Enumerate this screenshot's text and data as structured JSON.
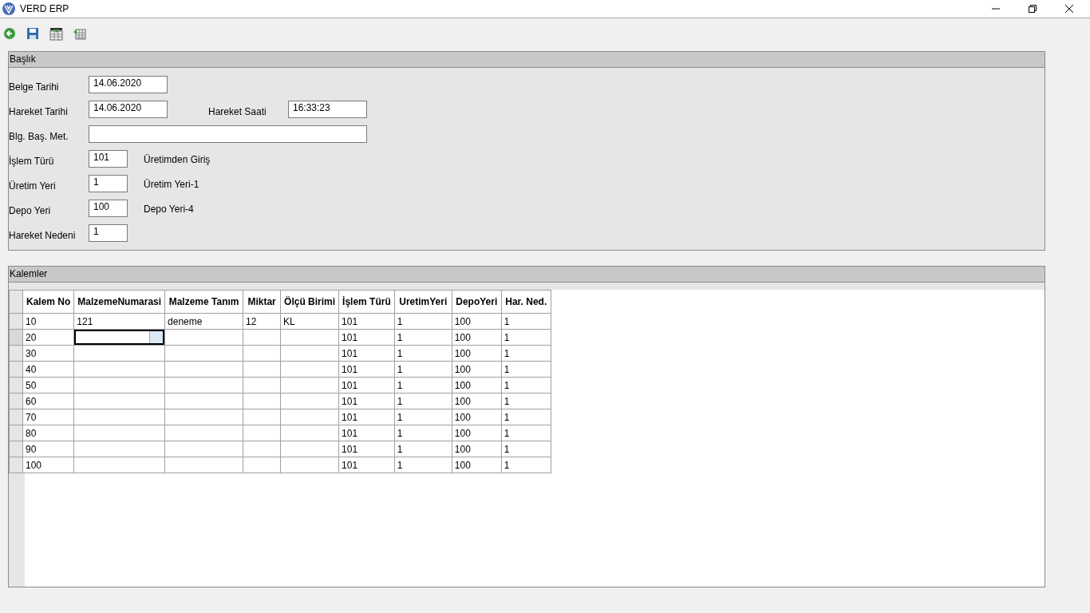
{
  "window": {
    "title": "VERD ERP"
  },
  "toolbar": [
    {
      "kind": "back"
    },
    {
      "kind": "save"
    },
    {
      "kind": "table-down"
    },
    {
      "kind": "table-left"
    }
  ],
  "header_panel": {
    "title": "Başlık",
    "fields": [
      {
        "label": "Belge Tarihi",
        "value": "14.06.2020",
        "kind": "date"
      },
      {
        "label": "Hareket Tarihi",
        "value": "14.06.2020",
        "kind": "date",
        "extra": {
          "label": "Hareket Saati",
          "value": "16:33:23"
        }
      },
      {
        "label": "Blg. Baş. Met.",
        "kind": "wide"
      },
      {
        "label": "İşlem Türü",
        "value": "101",
        "kind": "code",
        "note": "Üretimden Giriş"
      },
      {
        "label": "Üretim Yeri",
        "value": "1",
        "kind": "code",
        "note": "Üretim Yeri-1"
      },
      {
        "label": "Depo Yeri",
        "value": "100",
        "kind": "code",
        "note": "Depo Yeri-4"
      },
      {
        "label": "Hareket Nedeni",
        "value": "1",
        "kind": "code"
      }
    ]
  },
  "items_panel": {
    "title": "Kalemler",
    "table": {
      "columns": [
        {
          "label": "Kalem No",
          "selected": false
        },
        {
          "label": "MalzemeNumarasi",
          "selected": true
        },
        {
          "label": "Malzeme Tanım",
          "selected": false
        },
        {
          "label": "Miktar",
          "selected": false
        },
        {
          "label": "Ölçü Birimi",
          "selected": false
        },
        {
          "label": "İşlem Türü",
          "selected": false
        },
        {
          "label": "UretimYeri",
          "selected": false
        },
        {
          "label": "DepoYeri",
          "selected": false
        },
        {
          "label": "Har. Ned.",
          "selected": false
        }
      ],
      "rows": [
        {
          "cells": [
            "10",
            "121",
            "deneme",
            "12",
            "KL",
            "101",
            "1",
            "100",
            "1"
          ],
          "selected": false
        },
        {
          "cells": [
            "20",
            "",
            "",
            "",
            "",
            "101",
            "1",
            "100",
            "1"
          ],
          "selected": true
        },
        {
          "cells": [
            "30",
            "",
            "",
            "",
            "",
            "101",
            "1",
            "100",
            "1"
          ],
          "selected": false
        },
        {
          "cells": [
            "40",
            "",
            "",
            "",
            "",
            "101",
            "1",
            "100",
            "1"
          ],
          "selected": false
        },
        {
          "cells": [
            "50",
            "",
            "",
            "",
            "",
            "101",
            "1",
            "100",
            "1"
          ],
          "selected": false
        },
        {
          "cells": [
            "60",
            "",
            "",
            "",
            "",
            "101",
            "1",
            "100",
            "1"
          ],
          "selected": false
        },
        {
          "cells": [
            "70",
            "",
            "",
            "",
            "",
            "101",
            "1",
            "100",
            "1"
          ],
          "selected": false
        },
        {
          "cells": [
            "80",
            "",
            "",
            "",
            "",
            "101",
            "1",
            "100",
            "1"
          ],
          "selected": false
        },
        {
          "cells": [
            "90",
            "",
            "",
            "",
            "",
            "101",
            "1",
            "100",
            "1"
          ],
          "selected": false
        },
        {
          "cells": [
            "100",
            "",
            "",
            "",
            "",
            "101",
            "1",
            "100",
            "1"
          ],
          "selected": false
        }
      ]
    }
  }
}
